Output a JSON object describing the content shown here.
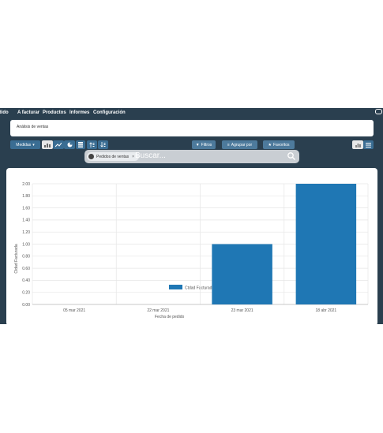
{
  "nav": {
    "items": [
      "dido",
      "A facturar",
      "Productos",
      "Informes",
      "Configuración"
    ]
  },
  "breadcrumb": "Análisis de ventas",
  "toolbar": {
    "measures_label": "Medidas",
    "filters_label": "Filtros",
    "group_by_label": "Agrupar por",
    "favorites_label": "Favoritos"
  },
  "search": {
    "facet_label": "Pedidos de ventas",
    "placeholder": "Buscar..."
  },
  "colors": {
    "nav_bg": "#2a3f4f",
    "bar": "#1f77b4",
    "button": "#3a6d93"
  },
  "icons": [
    "bar-chart-icon",
    "line-chart-icon",
    "pie-chart-icon",
    "stack-icon",
    "sort-asc-icon",
    "sort-desc-icon",
    "filter-icon",
    "layers-icon",
    "star-icon",
    "search-icon",
    "chat-icon",
    "graph-view-icon",
    "list-view-icon"
  ],
  "chart_data": {
    "type": "bar",
    "categories": [
      "05 mar 2021",
      "22 mar 2021",
      "23 mar 2021",
      "18 abr 2021"
    ],
    "series": [
      {
        "name": "Ctdad Facturada",
        "values": [
          0,
          0,
          1,
          2
        ]
      }
    ],
    "xlabel": "Fecha de pedido",
    "ylabel": "Ctdad Facturada",
    "ylim": [
      0,
      2
    ],
    "yticks": [
      "0.00",
      "0.20",
      "0.40",
      "0.60",
      "0.80",
      "1.00",
      "1.20",
      "1.40",
      "1.60",
      "1.80",
      "2.00"
    ],
    "grid": true,
    "legend": "top-center"
  }
}
